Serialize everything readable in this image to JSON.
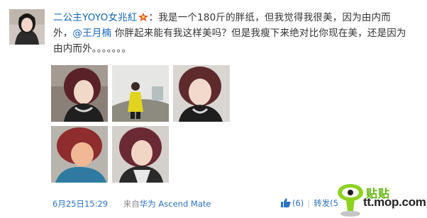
{
  "post": {
    "author": "二公主YOYO女兆紅",
    "text_part1": "：我是一个180斤的胖纸，但我觉得我很美，因为由内而外，",
    "mention": "@王月楠",
    "text_part2": " 你胖起来能有我这样美吗？但是我瘦下来绝对比你现在美，还是因为由内而外。。。。。。。"
  },
  "photos": [
    {
      "name": "photo-1"
    },
    {
      "name": "photo-2"
    },
    {
      "name": "photo-3"
    },
    {
      "name": "photo-4"
    },
    {
      "name": "photo-5"
    }
  ],
  "meta": {
    "time": "6月25日15:29",
    "source_label": "来自",
    "source_link": "华为 Ascend Mate"
  },
  "actions": {
    "like_count": "(6)",
    "separator": "|",
    "repost": "转发(5"
  },
  "watermark": {
    "brand_cn": "贴贴",
    "url": "tt.mop.com"
  },
  "colors": {
    "link": "#1565b7",
    "meta_link": "#2a71c0",
    "text": "#333333",
    "logo_green": "#63b50e"
  },
  "icons": [
    "vip-star-icon",
    "thumbs-up-icon",
    "mop-mascot-icon"
  ]
}
